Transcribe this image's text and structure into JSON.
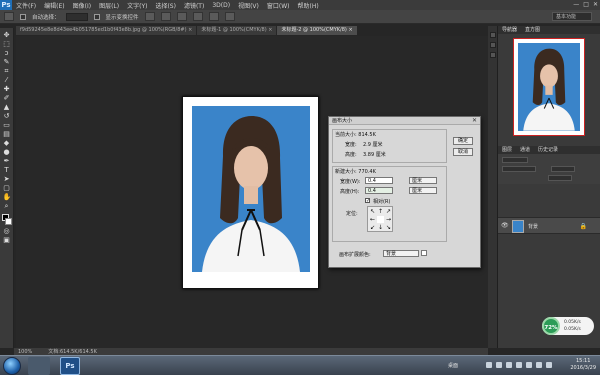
{
  "menubar": {
    "logo": "Ps",
    "items": [
      "文件(F)",
      "编辑(E)",
      "图像(I)",
      "图层(L)",
      "文字(Y)",
      "选择(S)",
      "滤镜(T)",
      "3D(D)",
      "视图(V)",
      "窗口(W)",
      "帮助(H)"
    ],
    "window_buttons": [
      "—",
      "□",
      "✕"
    ]
  },
  "options": {
    "auto_select_label": "自动选择：",
    "show_transform_label": "显示变换控件",
    "workspace": "基本功能"
  },
  "tabs": [
    {
      "label": "f9d59245e8e8d43ee4b051785ed1b0f43e8b.jpg @ 100%(RGB/8#) ×",
      "active": false
    },
    {
      "label": "未标题-1 @ 100%(CMYK/8) ×",
      "active": false
    },
    {
      "label": "未标题-2 @ 100%(CMYK/8) ×",
      "active": true
    }
  ],
  "dialog": {
    "title": "画布大小",
    "ok": "确定",
    "cancel": "取消",
    "current_size": "当前大小: 814.5K",
    "current_width_label": "宽度:",
    "current_width": "2.9 厘米",
    "current_height_label": "高度:",
    "current_height": "3.89 厘米",
    "new_size": "新建大小: 770.4K",
    "width_label": "宽度(W):",
    "width_value": "0.4",
    "width_unit": "厘米",
    "height_label": "高度(H):",
    "height_value": "0.4",
    "height_unit": "厘米",
    "relative_label": "相对(R)",
    "anchor_label": "定位:",
    "extension_label": "画布扩展颜色:",
    "extension_value": "背景"
  },
  "right_panel": {
    "nav_tabs": [
      "导航器",
      "直方图"
    ],
    "layers_tabs": [
      "图层",
      "通道",
      "历史记录"
    ],
    "layer_name": "背景"
  },
  "status": {
    "zoom": "100%",
    "doc": "文档:614.5K/614.5K"
  },
  "perf": {
    "percent": "72%",
    "up": "0.05K/s",
    "down": "0.05K/s"
  },
  "taskbar": {
    "ps_label": "Ps",
    "right_label": "桌面",
    "time": "15:11",
    "date": "2016/3/29"
  },
  "colors": {
    "photo_bg": "#3a84c9",
    "accent": "#1f6fb8"
  }
}
